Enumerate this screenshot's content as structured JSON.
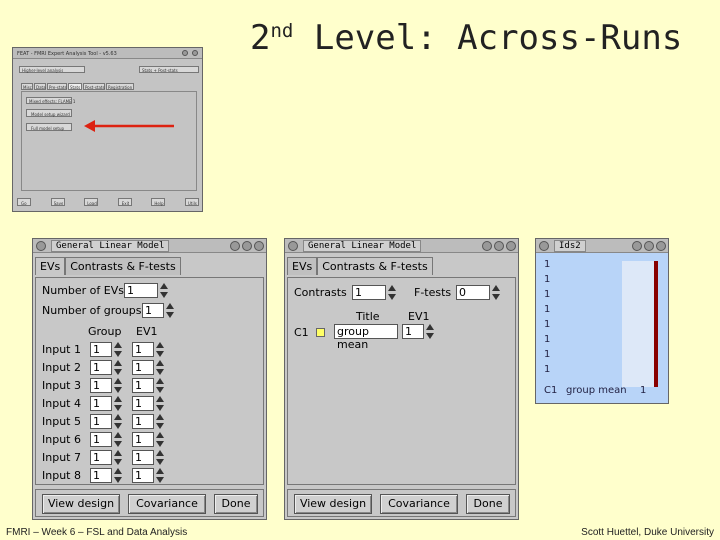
{
  "slide": {
    "title_main": "2",
    "title_sup": "nd",
    "title_rest": " Level: Across-Runs",
    "footer_left": "FMRI – Week 6 – FSL and Data Analysis",
    "footer_right": "Scott Huettel, Duke University",
    "arrow_color": "#dd2211"
  },
  "feat_window": {
    "title": "FEAT - FMRI Expert Analysis Tool - v5.63",
    "analysis_level": "Higher-level analysis",
    "analysis_type": "Stats + Post-stats",
    "tabs": [
      "Misc",
      "Data",
      "Pre-stats",
      "Stats",
      "Post-stats",
      "Registration"
    ],
    "mixed_effects": "Mixed effects: FLAME 1",
    "model_button": "Model setup wizard",
    "full_model_button": "Full model setup",
    "bottom_buttons": [
      "Go",
      "Save",
      "Load",
      "Exit",
      "Help",
      "Utils"
    ]
  },
  "glm_evs": {
    "title": "General Linear Model",
    "tabs": [
      "EVs",
      "Contrasts & F-tests"
    ],
    "num_evs_label": "Number of EVs",
    "num_evs": "1",
    "num_groups_label": "Number of groups",
    "num_groups": "1",
    "col_group": "Group",
    "col_ev1": "EV1",
    "inputs": [
      {
        "label": "Input 1",
        "group": "1",
        "ev1": "1"
      },
      {
        "label": "Input 2",
        "group": "1",
        "ev1": "1"
      },
      {
        "label": "Input 3",
        "group": "1",
        "ev1": "1"
      },
      {
        "label": "Input 4",
        "group": "1",
        "ev1": "1"
      },
      {
        "label": "Input 5",
        "group": "1",
        "ev1": "1"
      },
      {
        "label": "Input 6",
        "group": "1",
        "ev1": "1"
      },
      {
        "label": "Input 7",
        "group": "1",
        "ev1": "1"
      },
      {
        "label": "Input 8",
        "group": "1",
        "ev1": "1"
      }
    ],
    "buttons": [
      "View design",
      "Covariance",
      "Done"
    ]
  },
  "glm_contrasts": {
    "title": "General Linear Model",
    "tabs": [
      "EVs",
      "Contrasts & F-tests"
    ],
    "contrasts_label": "Contrasts",
    "contrasts": "1",
    "ftests_label": "F-tests",
    "ftests": "0",
    "col_title": "Title",
    "col_ev1": "EV1",
    "c1_label": "C1",
    "c1_title": "group mean",
    "c1_ev1": "1",
    "buttons": [
      "View design",
      "Covariance",
      "Done"
    ]
  },
  "design_window": {
    "title": "Ids2",
    "rows": [
      "1",
      "1",
      "1",
      "1",
      "1",
      "1",
      "1",
      "1"
    ],
    "contrast_label": "C1",
    "contrast_name": "group mean",
    "contrast_value": "1",
    "matrix_color": "#b8d4f8",
    "bar_color": "#880000"
  }
}
